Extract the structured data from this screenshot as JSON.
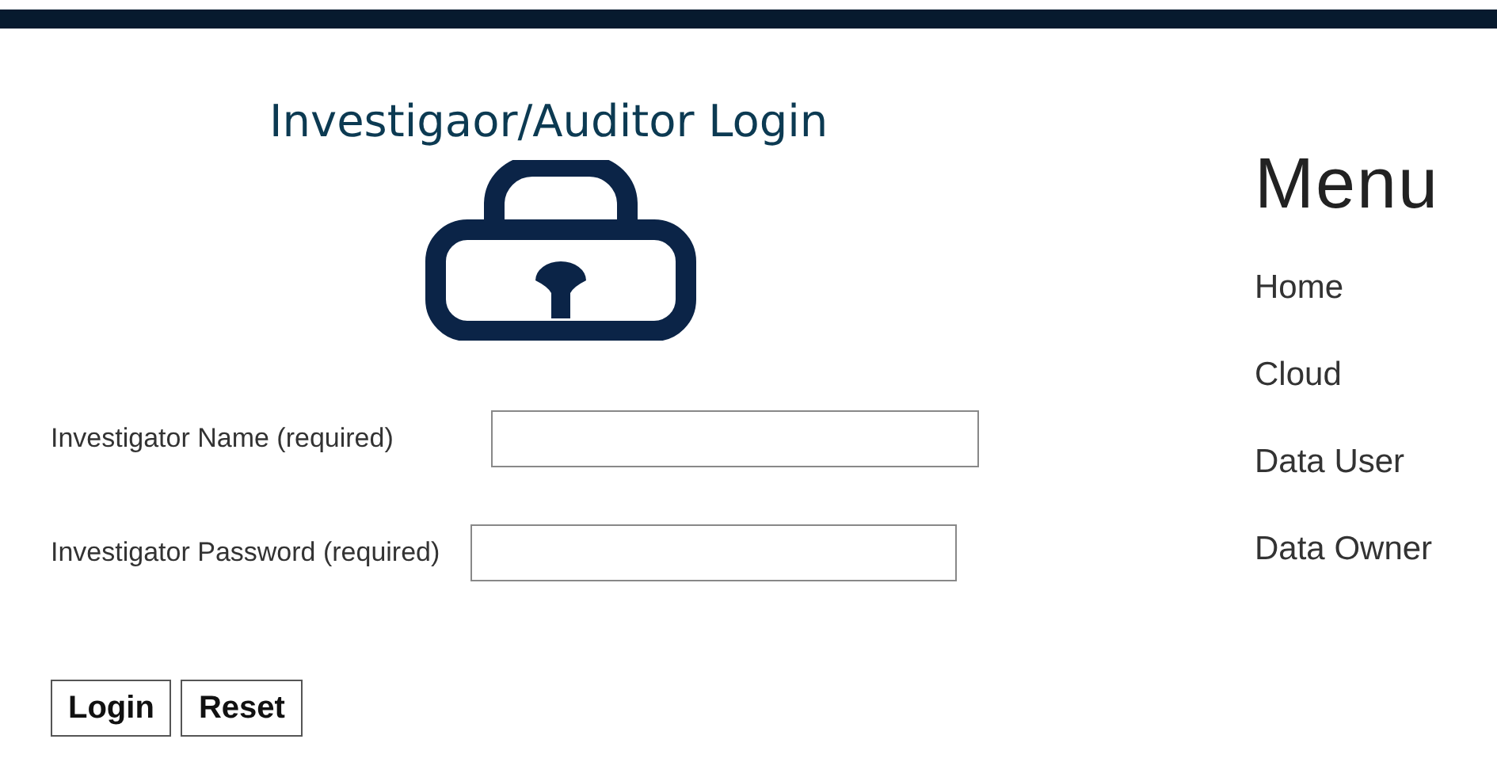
{
  "login": {
    "title": "Investigaor/Auditor Login",
    "fields": [
      {
        "label": "Investigator Name (required)"
      },
      {
        "label": "Investigator Password (required)"
      }
    ],
    "buttons": [
      "Login",
      "Reset"
    ]
  },
  "menu": {
    "title": "Menu",
    "items": [
      "Home",
      "Cloud",
      "Data User",
      "Data Owner"
    ]
  }
}
